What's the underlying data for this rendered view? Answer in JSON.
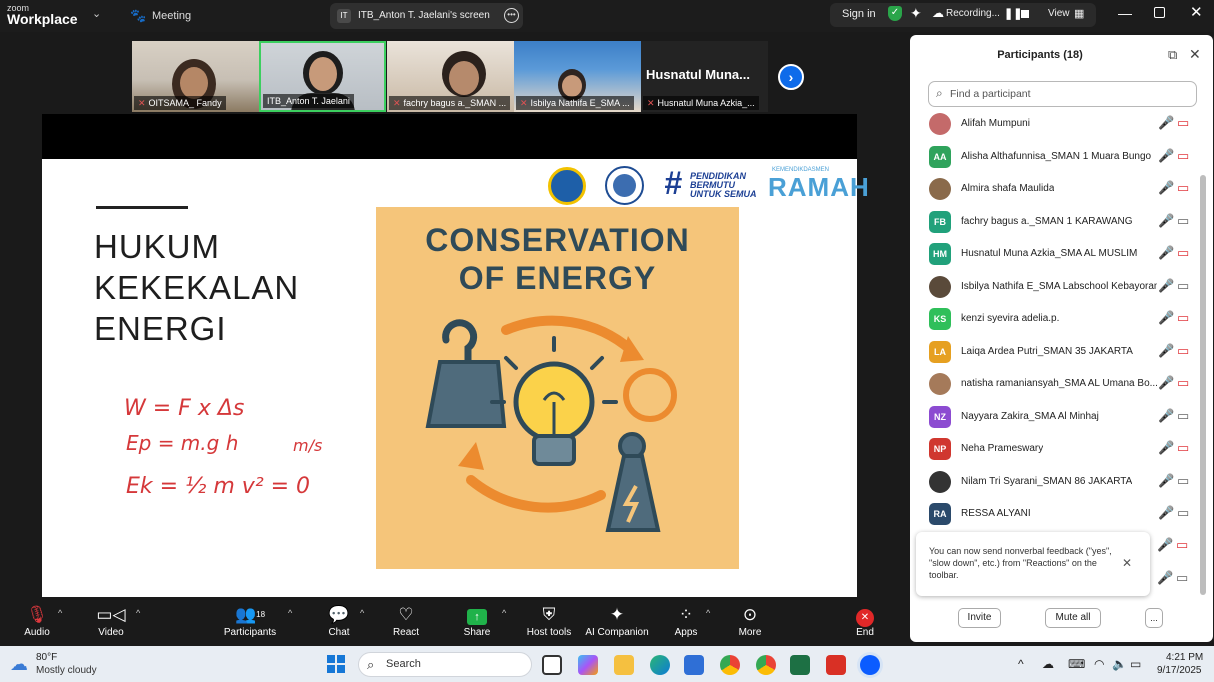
{
  "titlebar": {
    "logo_small": "zoom",
    "logo_main": "Workplace",
    "meeting_label": "Meeting",
    "tab_badge": "IT",
    "tab_label": "ITB_Anton T. Jaelani's screen",
    "signin_label": "Sign in",
    "recording_label": "Recording...",
    "view_label": "View"
  },
  "thumbnails": [
    {
      "name": "OITSAMA_ Fandy"
    },
    {
      "name": "ITB_Anton T. Jaelani"
    },
    {
      "name": "fachry bagus a._SMAN ..."
    },
    {
      "name": "Isbilya Nathifa E_SMA ..."
    },
    {
      "name": "Husnatul Muna Azkia_...",
      "big_name": "Husnatul Muna..."
    }
  ],
  "slide": {
    "title_lines": [
      "HUKUM",
      "KEKEKALAN",
      "ENERGI"
    ],
    "handwriting": [
      "W = F x Δs",
      "Ep = m.g h",
      "m/s",
      "Ek = ½ m v² = 0"
    ],
    "poster_title_lines": [
      "CONSERVATION",
      "OF ENERGY"
    ],
    "logo3_lines": [
      "PENDIDIKAN",
      "BERMUTU",
      "UNTUK SEMUA"
    ],
    "logo4_small": "KEMENDIKDASMEN",
    "logo4_text": "RAMAH"
  },
  "participants": {
    "title": "Participants (18)",
    "search_placeholder": "Find a participant",
    "list": [
      {
        "initials": "",
        "name": "Alifah Mumpuni",
        "color": "#c46a6a",
        "video_on": false
      },
      {
        "initials": "AA",
        "name": "Alisha Althafunnisa_SMAN 1 Muara Bungo",
        "color": "#2fa35c",
        "video_on": false
      },
      {
        "initials": "",
        "name": "Almira shafa Maulida",
        "color": "#8a6a4b",
        "video_on": false
      },
      {
        "initials": "FB",
        "name": "fachry bagus a._SMAN 1 KARAWANG",
        "color": "#21a17b",
        "video_on": true
      },
      {
        "initials": "HM",
        "name": "Husnatul Muna Azkia_SMA AL MUSLIM",
        "color": "#21a17b",
        "video_on": false
      },
      {
        "initials": "",
        "name": "Isbilya Nathifa E_SMA Labschool Kebayoran",
        "color": "#5a4a3a",
        "video_on": true
      },
      {
        "initials": "KS",
        "name": "kenzi syevira adelia.p.",
        "color": "#2fbf5a",
        "video_on": false
      },
      {
        "initials": "LA",
        "name": "Laiqa Ardea Putri_SMAN 35 JAKARTA",
        "color": "#e6a021",
        "video_on": false
      },
      {
        "initials": "",
        "name": "natisha ramaniansyah_SMA AL Umana Bo...",
        "color": "#a57a5a",
        "video_on": false
      },
      {
        "initials": "NZ",
        "name": "Nayyara Zakira_SMA Al Minhaj",
        "color": "#8c4bd1",
        "video_on": true
      },
      {
        "initials": "NP",
        "name": "Neha Prameswary",
        "color": "#d0372f",
        "video_on": false
      },
      {
        "initials": "",
        "name": "Nilam Tri Syarani_SMAN 86 JAKARTA",
        "color": "#333333",
        "video_on": true
      },
      {
        "initials": "RA",
        "name": "RESSA ALYANI",
        "color": "#2b4a6b",
        "video_on": true
      }
    ],
    "tip_text": "You can now send nonverbal feedback (\"yes\", \"slow down\", etc.) from \"Reactions\" on the toolbar.",
    "invite_label": "Invite",
    "mute_all_label": "Mute all",
    "more_label": "..."
  },
  "toolbar": {
    "audio": "Audio",
    "video": "Video",
    "participants": "Participants",
    "participants_count": "18",
    "chat": "Chat",
    "react": "React",
    "share": "Share",
    "host_tools": "Host tools",
    "ai_companion": "AI Companion",
    "apps": "Apps",
    "more": "More",
    "end": "End"
  },
  "taskbar": {
    "temp": "80°F",
    "weather": "Mostly cloudy",
    "search_label": "Search",
    "time": "4:21 PM",
    "date": "9/17/2025"
  },
  "colors": {
    "accent_blue": "#0e6bea",
    "end_red": "#e02828",
    "share_green": "#20b24a",
    "muted_red": "#e0383e"
  }
}
